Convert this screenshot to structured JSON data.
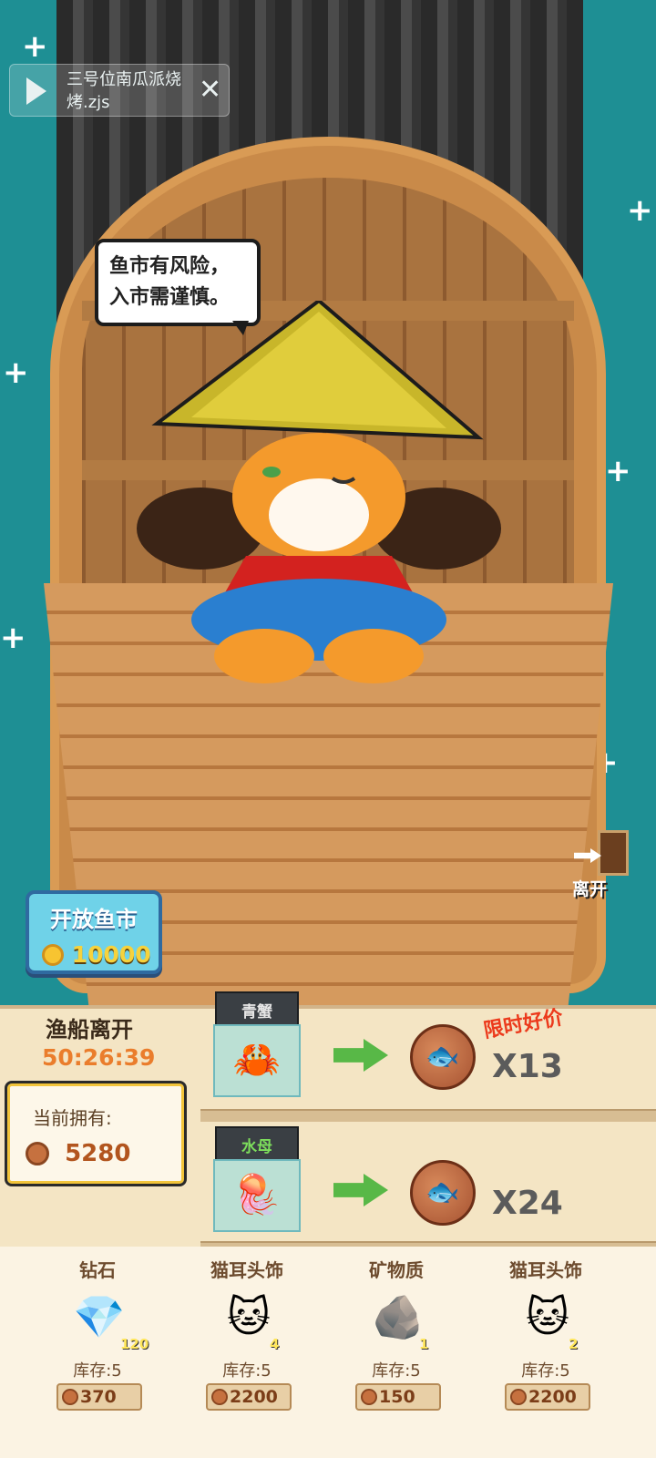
{
  "replay": {
    "title": "三号位南瓜派烧烤.zjs"
  },
  "bubble": {
    "line1": "鱼市有风险，",
    "line2": "入市需谨慎。"
  },
  "open_market": {
    "label": "开放鱼市",
    "cost": "10000"
  },
  "leave": {
    "label": "离开"
  },
  "boat": {
    "departs_label": "渔船离开",
    "timer": "50:26:39"
  },
  "owned": {
    "label": "当前拥有:",
    "value": "5280"
  },
  "deal_tag": "限时好价",
  "trades": [
    {
      "item": "青蟹",
      "multiplier": "X13",
      "icon": "crab-icon"
    },
    {
      "item": "水母",
      "multiplier": "X24",
      "icon": "jellyfish-icon"
    }
  ],
  "shop": [
    {
      "name": "钻石",
      "count": "120",
      "stock": "库存:5",
      "price": "370",
      "icon": "diamond-icon"
    },
    {
      "name": "猫耳头饰",
      "count": "4",
      "stock": "库存:5",
      "price": "2200",
      "icon": "cat-ear-headband-icon"
    },
    {
      "name": "矿物质",
      "count": "1",
      "stock": "库存:5",
      "price": "150",
      "icon": "mineral-icon"
    },
    {
      "name": "猫耳头饰",
      "count": "2",
      "stock": "库存:5",
      "price": "2200",
      "icon": "cat-ear-headband-icon"
    }
  ],
  "colors": {
    "sea": "#1e8f94",
    "panel": "#f4e5c4",
    "accent_orange": "#ea7d2c",
    "deal_red": "#ec3a1c"
  }
}
